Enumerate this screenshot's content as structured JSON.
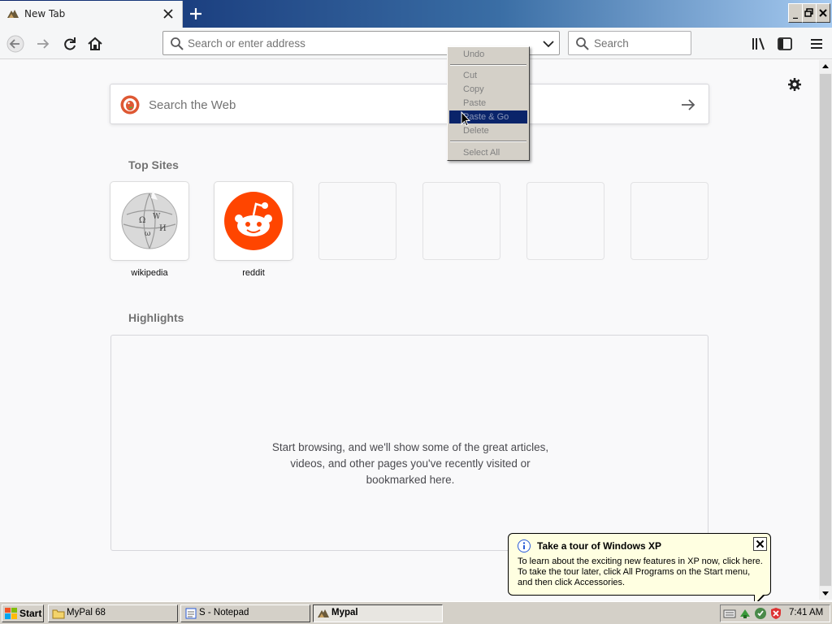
{
  "browser": {
    "tab_title": "New Tab",
    "urlbar_placeholder": "Search or enter address",
    "searchbar_placeholder": "Search"
  },
  "newtab": {
    "websearch_placeholder": "Search the Web",
    "top_sites_title": "Top Sites",
    "top_sites": [
      {
        "label": "wikipedia",
        "icon": "wikipedia-globe-icon"
      },
      {
        "label": "reddit",
        "icon": "reddit-alien-icon"
      },
      {
        "label": "",
        "icon": ""
      },
      {
        "label": "",
        "icon": ""
      },
      {
        "label": "",
        "icon": ""
      },
      {
        "label": "",
        "icon": ""
      }
    ],
    "highlights_title": "Highlights",
    "highlights_message": "Start browsing, and we'll show some of the great articles, videos, and other pages you've recently visited or bookmarked here."
  },
  "context_menu": {
    "items": [
      "Undo",
      "Cut",
      "Copy",
      "Paste",
      "Paste & Go",
      "Delete",
      "Select All"
    ],
    "highlighted": "Paste & Go"
  },
  "balloon": {
    "title": "Take a tour of Windows XP",
    "body": "To learn about the exciting new features in XP now, click here. To take the tour later, click All Programs on the Start menu, and then click Accessories."
  },
  "taskbar": {
    "start_label": "Start",
    "buttons": [
      {
        "label": "MyPal 68",
        "icon": "folder-icon"
      },
      {
        "label": "S - Notepad",
        "icon": "notepad-icon"
      },
      {
        "label": "Mypal",
        "icon": "mypal-icon"
      }
    ],
    "clock": "7:41 AM"
  },
  "colors": {
    "titlebar_start": "#0a246a",
    "titlebar_end": "#a6caf0",
    "menu_highlight": "#0a246a",
    "reddit_orange": "#ff4500",
    "balloon_bg": "#ffffe1",
    "xp_face": "#d4d0c8"
  }
}
